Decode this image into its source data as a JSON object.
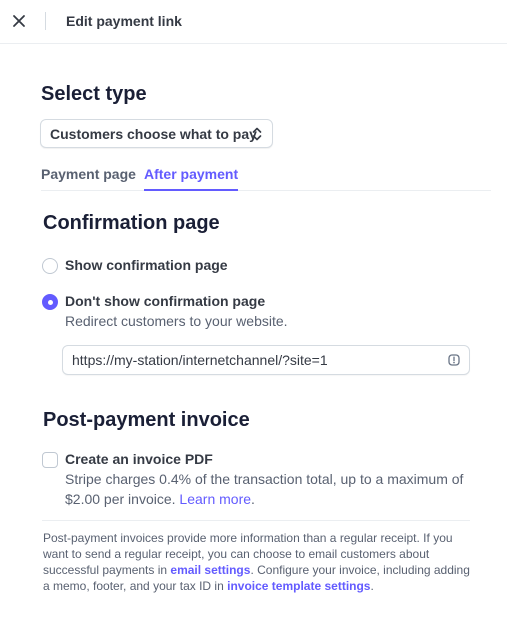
{
  "header": {
    "title": "Edit payment link",
    "close_icon": "close-icon"
  },
  "select_type": {
    "heading": "Select type",
    "value": "Customers choose what to pay",
    "icon": "chevron-up-down-icon"
  },
  "tabs": [
    {
      "label": "Payment page",
      "active": false
    },
    {
      "label": "After payment",
      "active": true
    }
  ],
  "confirmation": {
    "heading": "Confirmation page",
    "options": [
      {
        "label": "Show confirmation page",
        "checked": false
      },
      {
        "label": "Don't show confirmation page",
        "checked": true,
        "description": "Redirect customers to your website."
      }
    ],
    "redirect_url": "https://my-station/internetchannel/?site=1",
    "url_icon": "info-icon"
  },
  "invoice": {
    "heading": "Post-payment invoice",
    "checkbox_label": "Create an invoice PDF",
    "checked": false,
    "desc_text": "Stripe charges 0.4% of the transaction total, up to a maximum of $2.00 per invoice.",
    "learn_more": "Learn more",
    "desc_end": "."
  },
  "footer_note": {
    "part1": "Post-payment invoices provide more information than a regular receipt. If you want to send a regular receipt, you can choose to email customers about successful payments in",
    "link1": "email settings",
    "part2": ". Configure your invoice, including adding a memo, footer, and your tax ID in",
    "link2": "invoice template settings",
    "part3": "."
  },
  "colors": {
    "accent": "#635bff",
    "text_primary": "#1a1f36",
    "text_secondary": "#596171",
    "border": "#d5dbe1"
  }
}
